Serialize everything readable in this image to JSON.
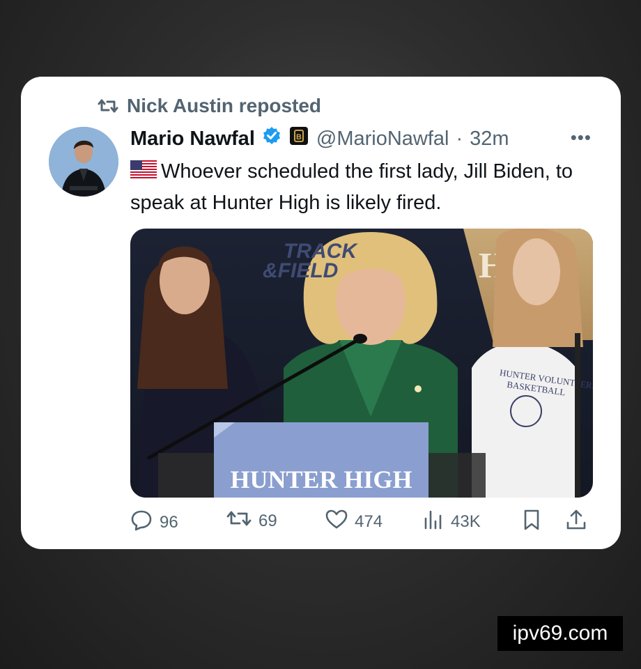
{
  "repost": {
    "label": "Nick Austin reposted",
    "icon": "repost-icon"
  },
  "author": {
    "name": "Mario Nawfal",
    "handle": "@MarioNawfal",
    "time": "32m",
    "verified_icon": "verified-badge-icon",
    "affiliate_icon": "affiliate-badge-icon",
    "avatar_icon": "avatar"
  },
  "tweet": {
    "flag_icon": "us-flag-icon",
    "text": "Whoever scheduled the first lady, Jill Biden, to speak at Hunter High is likely fired."
  },
  "media": {
    "podium_text": "HUNTER HIGH",
    "banner_text": "TRACK & FIELD",
    "shirt_text": "HUNTER VOLUNTEERS BASKETBALL"
  },
  "actions": {
    "replies": "96",
    "reposts": "69",
    "likes": "474",
    "views": "43K"
  },
  "watermark": "ipv69.com",
  "colors": {
    "text": "#0f1419",
    "muted": "#536471",
    "verified": "#1d9bf0"
  }
}
